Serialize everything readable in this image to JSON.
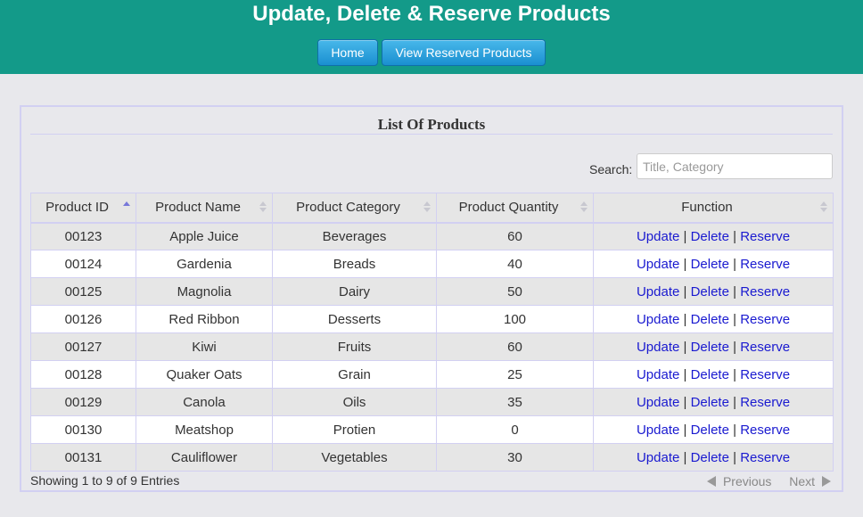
{
  "header": {
    "title": "Update, Delete & Reserve Products",
    "bg_color": "#139a89",
    "nav": [
      {
        "label": "Home"
      },
      {
        "label": "View Reserved Products"
      }
    ]
  },
  "panel": {
    "title": "List Of Products",
    "search_label": "Search:",
    "search_placeholder": "Title, Category",
    "search_value": ""
  },
  "table": {
    "columns": [
      {
        "label": "Product ID",
        "sorted": "asc"
      },
      {
        "label": "Product Name",
        "sorted": "none"
      },
      {
        "label": "Product Category",
        "sorted": "none"
      },
      {
        "label": "Product Quantity",
        "sorted": "none"
      },
      {
        "label": "Function",
        "sorted": "none"
      }
    ],
    "actions": [
      "Update",
      "Delete",
      "Reserve"
    ],
    "action_separator": "|",
    "link_color": "#1a1ad0",
    "rows": [
      {
        "id": "00123",
        "name": "Apple Juice",
        "category": "Beverages",
        "quantity": "60"
      },
      {
        "id": "00124",
        "name": "Gardenia",
        "category": "Breads",
        "quantity": "40"
      },
      {
        "id": "00125",
        "name": "Magnolia",
        "category": "Dairy",
        "quantity": "50"
      },
      {
        "id": "00126",
        "name": "Red Ribbon",
        "category": "Desserts",
        "quantity": "100"
      },
      {
        "id": "00127",
        "name": "Kiwi",
        "category": "Fruits",
        "quantity": "60"
      },
      {
        "id": "00128",
        "name": "Quaker Oats",
        "category": "Grain",
        "quantity": "25"
      },
      {
        "id": "00129",
        "name": "Canola",
        "category": "Oils",
        "quantity": "35"
      },
      {
        "id": "00130",
        "name": "Meatshop",
        "category": "Protien",
        "quantity": "0"
      },
      {
        "id": "00131",
        "name": "Cauliflower",
        "category": "Vegetables",
        "quantity": "30"
      }
    ]
  },
  "footer": {
    "info": "Showing 1 to 9 of 9 Entries",
    "previous": "Previous",
    "next": "Next"
  }
}
